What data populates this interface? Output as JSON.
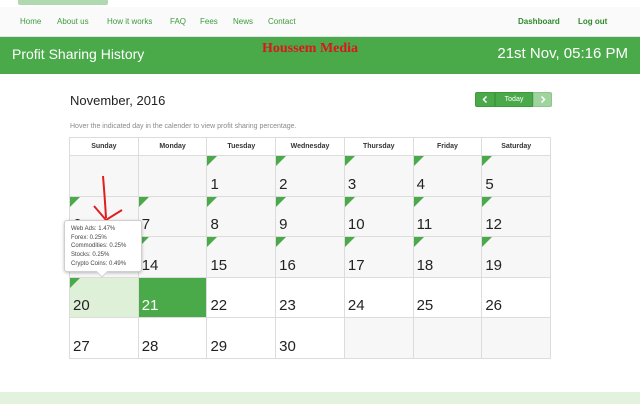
{
  "nav": {
    "links": [
      "Home",
      "About us",
      "How it works",
      "FAQ",
      "Fees",
      "News",
      "Contact"
    ],
    "right_links": [
      "Dashboard",
      "Log out"
    ]
  },
  "hero": {
    "title": "Profit Sharing History",
    "watermark": "Houssem Media",
    "datetime": "21st Nov, 05:16 PM"
  },
  "calendar": {
    "month": "November, 2016",
    "today_label": "Today",
    "prev_icon": "chevron-left-icon",
    "next_icon": "chevron-right-icon",
    "hint": "Hover the indicated day in the calender to view profit sharing percentage.",
    "weekdays": [
      "Sunday",
      "Monday",
      "Tuesday",
      "Wednesday",
      "Thursday",
      "Friday",
      "Saturday"
    ],
    "weeks": [
      [
        "",
        "",
        "1",
        "2",
        "3",
        "4",
        "5"
      ],
      [
        "6",
        "7",
        "8",
        "9",
        "10",
        "11",
        "12"
      ],
      [
        "13",
        "14",
        "15",
        "16",
        "17",
        "18",
        "19"
      ],
      [
        "20",
        "21",
        "22",
        "23",
        "24",
        "25",
        "26"
      ],
      [
        "27",
        "28",
        "29",
        "30",
        "",
        "",
        ""
      ]
    ],
    "flagged_days": [
      "1",
      "2",
      "3",
      "4",
      "5",
      "6",
      "7",
      "8",
      "9",
      "10",
      "11",
      "12",
      "13",
      "14",
      "15",
      "16",
      "17",
      "18",
      "19",
      "20"
    ],
    "highlight_day": "20",
    "current_day": "21"
  },
  "tooltip": {
    "lines": [
      "Web Ads: 1.47%",
      "Forex: 0.25%",
      "Commodities: 0.25%",
      "Stocks: 0.25%",
      "Crypto Coins: 0.49%"
    ]
  },
  "colors": {
    "accent": "#4aaa4a",
    "watermark": "#d9171c",
    "annotation": "#e02020"
  }
}
